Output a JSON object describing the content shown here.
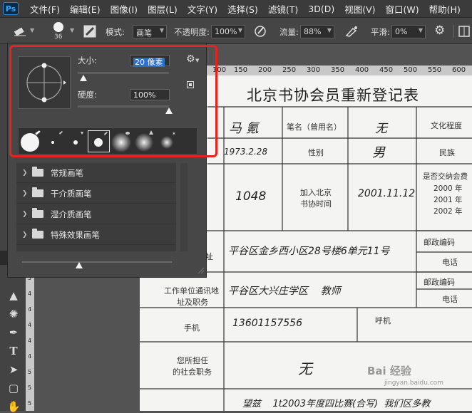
{
  "app": {
    "logo": "Ps"
  },
  "menubar": {
    "items": [
      "文件(F)",
      "编辑(E)",
      "图像(I)",
      "图层(L)",
      "文字(Y)",
      "选择(S)",
      "滤镜(T)",
      "3D(D)",
      "视图(V)",
      "窗口(W)",
      "帮助(H)"
    ]
  },
  "options": {
    "brush_size": "36",
    "mode_label": "模式:",
    "mode_value": "画笔",
    "opacity_label": "不透明度:",
    "opacity_value": "100%",
    "flow_label": "流量:",
    "flow_value": "88%",
    "smoothing_label": "平滑:",
    "smoothing_value": "0%"
  },
  "brush_panel": {
    "size_label": "大小:",
    "size_value": "20 像素",
    "size_fraction": 0.06,
    "hardness_label": "硬度:",
    "hardness_value": "100%",
    "hardness_fraction": 1.0,
    "tip_sizes": [
      "",
      "",
      "",
      "",
      "",
      "",
      ""
    ],
    "groups": [
      "常规画笔",
      "干介质画笔",
      "湿介质画笔",
      "特殊效果画笔"
    ],
    "bottom_slider_fraction": 0.38
  },
  "ruler_h": [
    "100",
    "150",
    "200",
    "250",
    "300",
    "350",
    "400",
    "450",
    "500",
    "550",
    "600"
  ],
  "ruler_v": [
    "3",
    "4",
    "4",
    "4",
    "4",
    "4",
    "5",
    "5",
    "5"
  ],
  "document": {
    "title": "北京书协会员重新登记表",
    "row1": {
      "name": "马 氪",
      "alias_label": "笔名（曾用名）",
      "alias_value": "无",
      "edu_label": "文化程度"
    },
    "row2": {
      "birth": "1973.2.28",
      "gender_label": "性别",
      "gender_value": "男",
      "ethnicity_label": "民族"
    },
    "row3": {
      "member_no": "1048",
      "join_label_1": "加入北京",
      "join_label_2": "书协时间",
      "join_value": "2001.11.12",
      "renew_label_1": "是否交纳会费",
      "renew_years": [
        "2000 年",
        "2001 年",
        "2002 年"
      ]
    },
    "row4": {
      "addr_label": "址",
      "addr_value": "平谷区金乡西小区28号楼6单元11号",
      "postal_label": "邮政编码",
      "phone_label": "电话"
    },
    "row5": {
      "work_label_1": "工作单位通讯地",
      "work_label_2": "址及职务",
      "work_value": "平谷区大兴庄学区    教师",
      "postal_label": "邮政编码",
      "phone_label": "电话"
    },
    "row6": {
      "mobile_label": "手机",
      "mobile_value": "13601157556",
      "pager_label": "呼机"
    },
    "row7": {
      "duty_label_1": "您所担任",
      "duty_label_2": "的社会职务",
      "duty_value": "无"
    },
    "row8": {
      "bottom_text": "望兹    1t2003年度四比赛(合写)  我们区多教"
    }
  },
  "watermark": {
    "main": "Bai 经验",
    "sub": "jingyan.baidu.com"
  }
}
